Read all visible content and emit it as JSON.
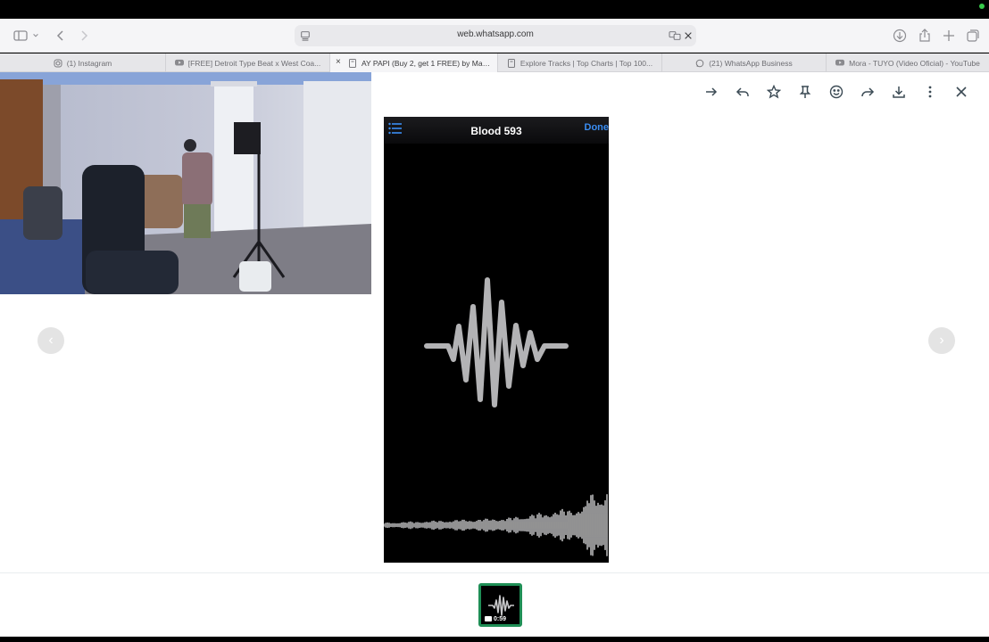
{
  "browser": {
    "url": "web.whatsapp.com",
    "icons": [
      "sidebar-icon",
      "chevron-down-icon",
      "back-icon",
      "forward-icon",
      "download-icon",
      "share-icon",
      "new-tab-icon",
      "tab-overview-icon",
      "reader-icon",
      "translate-icon",
      "close-icon"
    ]
  },
  "tabs": [
    {
      "label": "(1) Instagram",
      "icon": "instagram-icon"
    },
    {
      "label": "[FREE] Detroit Type Beat x West Coa...",
      "icon": "youtube-icon"
    },
    {
      "label": "AY PAPI (Buy 2, get 1 FREE) by Manu...",
      "icon": "page-icon"
    },
    {
      "label": "Explore Tracks | Top Charts | Top 100...",
      "icon": "page-icon"
    },
    {
      "label": "(21) WhatsApp Business",
      "icon": "whatsapp-icon"
    },
    {
      "label": "Mora - TUYO (Video Oficial) - YouTube",
      "icon": "youtube-icon"
    }
  ],
  "viewer": {
    "actions": [
      "forward-icon",
      "reply-icon",
      "star-icon",
      "pin-icon",
      "emoji-icon",
      "share-icon",
      "download-icon",
      "more-icon",
      "close-icon"
    ],
    "media": {
      "title": "Blood 593",
      "done_label": "Done"
    },
    "prev_label": "‹",
    "next_label": "›",
    "thumbnail": {
      "duration": "0:59"
    }
  },
  "colors": {
    "accent_green": "#1f8f56",
    "ios_blue": "#3a8df2",
    "wave_gray": "#b3b3b5"
  }
}
